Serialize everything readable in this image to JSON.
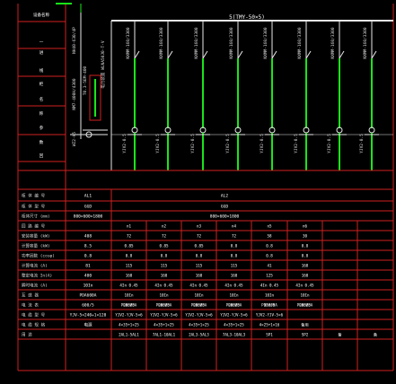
{
  "colors": {
    "background": "#000000",
    "grid": "#d11f1f",
    "text": "#ffffff",
    "busbar": "#e8e8e8",
    "cable": "#19e619",
    "breaker": "#ffffff",
    "label": "#d9d9d9"
  },
  "header_glyphs": [
    "设备名称",
    "一",
    "进",
    "线",
    "柜",
    "名",
    "称",
    "参",
    "数",
    "回",
    "路",
    "及",
    "电",
    "缆"
  ],
  "busbar_label": "5(TMY-50×5)",
  "incomer": {
    "label_top": "NH40-630/4P",
    "label_mid": "NM7-400H/4300",
    "label_v": "T0.3-5EM-400",
    "label_v2": "电力装置 WLNA50J0-T-V",
    "meter_label": "WZ2-H5"
  },
  "feeders": [
    {
      "breaker": "NXMM-160/3300",
      "cable": "YJV2-0.5"
    },
    {
      "breaker": "NXMM-160/3300",
      "cable": "YJV2-0.5"
    },
    {
      "breaker": "NXMM-160/3300",
      "cable": "YJV2-0.5"
    },
    {
      "breaker": "NXMM-160/3300",
      "cable": "YJV2-0.5"
    },
    {
      "breaker": "NXMM-160/3300",
      "cable": "YJV2-0.5"
    },
    {
      "breaker": "NXMM-160/3300",
      "cable": "YJV2-0.5"
    },
    {
      "breaker": "NXMM-160/3300",
      "cable": "YJV2-0.5"
    },
    {
      "breaker": "NXMM-160/3300",
      "cable": "YJV2-0.5"
    }
  ],
  "table": {
    "row_labels": [
      "柜 体 编 号",
      "柜 体 型 号",
      "柜体尺寸 (mm)",
      "回 路 编 号",
      "安装容量 (kW)",
      "计算容量 (kW)",
      "功率因数 (cosφ)",
      "计算电流   (A)",
      "整定电流 In(A)",
      "瞬时电流 (A)",
      "互 感 器",
      "电 流 表",
      "电 缆 型 号",
      "电 缆 规 格",
      "用   途"
    ],
    "col_AL1": [
      "AL1",
      "GGD",
      "800×600×1800",
      "",
      "408",
      "8.5",
      "0.8",
      "81",
      "400",
      "10In",
      "PDA600A",
      "600/5",
      "YJV-5×240+1×120",
      "电源",
      ""
    ],
    "col_AL2_merged": [
      "AL2",
      "GGD",
      "800×600×1800"
    ],
    "circuits": [
      {
        "no": "n1",
        "inst": "72",
        "calc": "0.85",
        "pf": "0.8",
        "ic": "115",
        "set": "160",
        "ins": "4In  0.45",
        "inst2": "10In",
        "ct": "200/5",
        "amp": "PDA600A",
        "cable": "YJV2-YJV-5×6",
        "spec": "4×35+1×25",
        "use": "2AL1-5AL1"
      },
      {
        "no": "n2",
        "inst": "72",
        "calc": "0.85",
        "pf": "0.8",
        "ic": "115",
        "set": "160",
        "ins": "4In  0.45",
        "inst2": "10In",
        "ct": "200/5",
        "amp": "PDA600A",
        "cable": "YJV2-YJV-5×6",
        "spec": "4×35+1×25",
        "use": "7AL1-10AL1"
      },
      {
        "no": "n3",
        "inst": "72",
        "calc": "0.85",
        "pf": "0.8",
        "ic": "115",
        "set": "160",
        "ins": "4In  0.45",
        "inst2": "10In",
        "ct": "200/5",
        "amp": "PDA600A",
        "cable": "YJV2-YJV-5×6",
        "spec": "4×35+1×25",
        "use": "2AL3-5AL3"
      },
      {
        "no": "n4",
        "inst": "72",
        "calc": "0.8",
        "pf": "0.8",
        "ic": "115",
        "set": "160",
        "ins": "4In  0.45",
        "inst2": "10In",
        "ct": "200/5",
        "amp": "PDA600A",
        "cable": "YJV2-YJV-5×6",
        "spec": "4×35+1×25",
        "use": "7AL3-10AL3"
      },
      {
        "no": "n5",
        "inst": "58",
        "calc": "0.8",
        "pf": "0.8",
        "ic": "41",
        "set": "125",
        "ins": "4In  0.45",
        "inst2": "10In",
        "ct": "150/5",
        "amp": "PDA600A",
        "cable": "YJV2-YJV-5×6",
        "spec": "4×25+1×16",
        "use": "SP1"
      },
      {
        "no": "n6",
        "inst": "30",
        "calc": "0.8",
        "pf": "0.8",
        "ic": "168",
        "set": "160",
        "ins": "4In  0.45",
        "inst2": "10In",
        "ct": "200/5",
        "amp": "PDA600A",
        "cable": "",
        "spec": "备用",
        "use": "SP2"
      },
      {
        "no": "",
        "inst": "",
        "calc": "",
        "pf": "",
        "ic": "",
        "set": "",
        "ins": "",
        "inst2": "",
        "ct": "",
        "amp": "",
        "cable": "",
        "spec": "",
        "use": "备"
      },
      {
        "no": "",
        "inst": "",
        "calc": "",
        "pf": "",
        "ic": "",
        "set": "",
        "ins": "",
        "inst2": "",
        "ct": "",
        "amp": "",
        "cable": "",
        "spec": "",
        "use": "备"
      }
    ]
  }
}
